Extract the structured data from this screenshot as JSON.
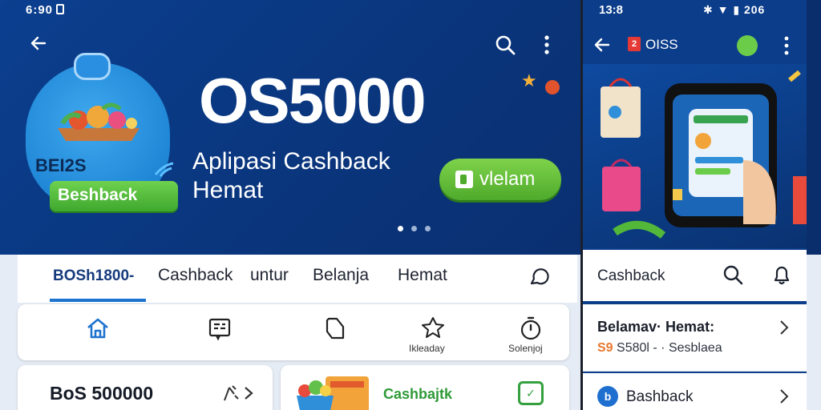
{
  "left": {
    "status_time": "6:90",
    "promo": {
      "badge_title": "BEI2S",
      "badge_pill": "Beshback"
    },
    "hero": {
      "brand": "OS5000",
      "subtitle_line1": "Aplipasi Cashback",
      "subtitle_line2": "Hemat",
      "cta_label": "vlelam"
    },
    "tabs": [
      {
        "label": "BOSh1800-"
      },
      {
        "label": "Cashback"
      },
      {
        "label": "untur"
      },
      {
        "label": "Belanja"
      },
      {
        "label": "Hemat"
      }
    ],
    "quick_icons": [
      {
        "icon": "home-icon",
        "label": ""
      },
      {
        "icon": "receipt-icon",
        "label": ""
      },
      {
        "icon": "tag-icon",
        "label": ""
      },
      {
        "icon": "star-badge-icon",
        "label": "Ikleaday"
      },
      {
        "icon": "timer-icon",
        "label": "Solenjoj"
      }
    ],
    "card_a": {
      "title": "BoS 500000"
    },
    "card_b": {
      "title": "Cashbajtk"
    }
  },
  "right": {
    "status_time": "13:8",
    "status_right": "206",
    "header_logo": "2",
    "header_title": "OISS",
    "tab_label": "Cashback",
    "row1": {
      "title": "Belamav· Hemat:",
      "sub_prefix": "S9",
      "sub_text": "S580l - · Sesblaea"
    },
    "row2": {
      "label": "Bashback",
      "icon_letter": "b"
    }
  },
  "colors": {
    "hero_blue": "#0b3f8f",
    "accent_green": "#4eaa2b",
    "tab_underline": "#1e73cf"
  }
}
